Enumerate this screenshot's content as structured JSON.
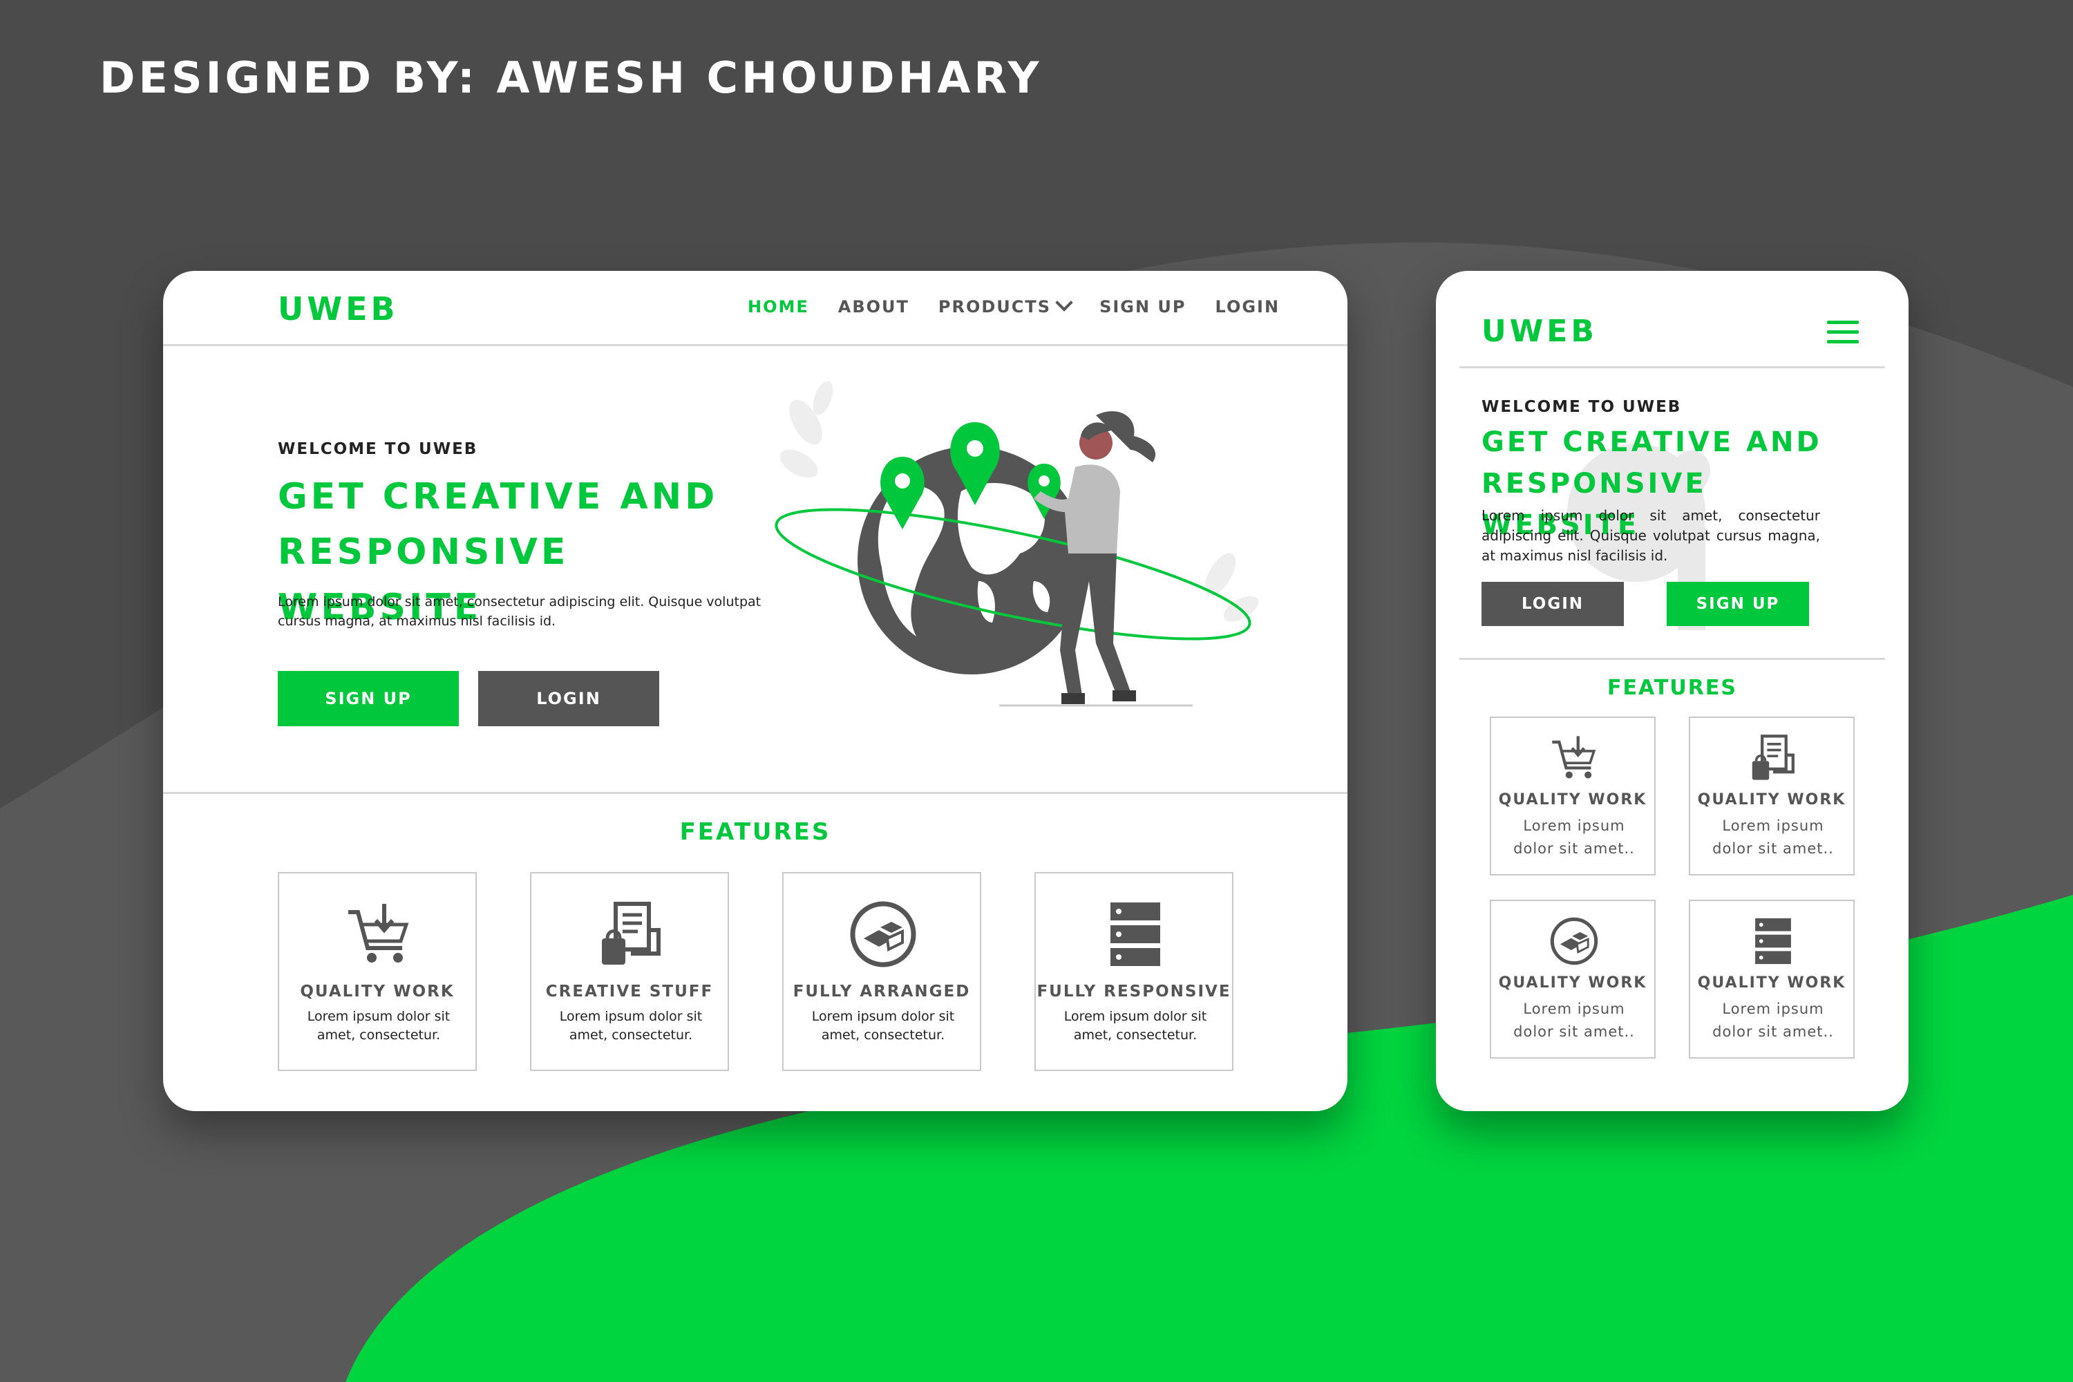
{
  "credit": "DESIGNED BY: AWESH CHOUDHARY",
  "colors": {
    "accent": "#00c73c",
    "dark": "#4b4b4b",
    "button_dark": "#555555"
  },
  "desktop": {
    "logo": "UWEB",
    "nav": {
      "home": "HOME",
      "about": "ABOUT",
      "products": "PRODUCTS",
      "signup": "SIGN UP",
      "login": "LOGIN"
    },
    "hero": {
      "welcome": "WELCOME TO UWEB",
      "headline_1": "GET CREATIVE AND",
      "headline_2": "RESPONSIVE WEBSITE",
      "body": "Lorem ipsum dolor sit amet, consectetur adipiscing elit. Quisque volutpat cursus magna, at maximus nisl facilisis id.",
      "signup": "SIGN UP",
      "login": "LOGIN"
    },
    "features_title": "FEATURES",
    "features": [
      {
        "icon": "cart-download-icon",
        "title": "QUALITY WORK",
        "desc": "Lorem ipsum dolor sit amet, consectetur."
      },
      {
        "icon": "bag-document-icon",
        "title": "CREATIVE STUFF",
        "desc": "Lorem ipsum dolor sit amet, consectetur."
      },
      {
        "icon": "boxes-circle-icon",
        "title": "FULLY ARRANGED",
        "desc": "Lorem ipsum dolor sit amet, consectetur."
      },
      {
        "icon": "server-stack-icon",
        "title": "FULLY RESPONSIVE",
        "desc": "Lorem ipsum dolor sit amet, consectetur."
      }
    ]
  },
  "mobile": {
    "logo": "UWEB",
    "menu_icon": "hamburger-menu-icon",
    "hero": {
      "welcome": "WELCOME TO UWEB",
      "headline_1": "GET CREATIVE AND",
      "headline_2": "RESPONSIVE WEBSITE",
      "body": "Lorem ipsum dolor sit amet, consectetur adipiscing elit. Quisque volutpat cursus magna, at maximus nisl facilisis id.",
      "login": "LOGIN",
      "signup": "SIGN UP"
    },
    "features_title": "FEATURES",
    "features": [
      {
        "icon": "cart-download-icon",
        "title": "QUALITY WORK",
        "desc": "Lorem ipsum dolor sit amet.."
      },
      {
        "icon": "bag-document-icon",
        "title": "QUALITY WORK",
        "desc": "Lorem ipsum dolor sit amet.."
      },
      {
        "icon": "boxes-circle-icon",
        "title": "QUALITY WORK",
        "desc": "Lorem ipsum dolor sit amet.."
      },
      {
        "icon": "server-stack-icon",
        "title": "QUALITY WORK",
        "desc": "Lorem ipsum dolor sit amet.."
      }
    ]
  }
}
